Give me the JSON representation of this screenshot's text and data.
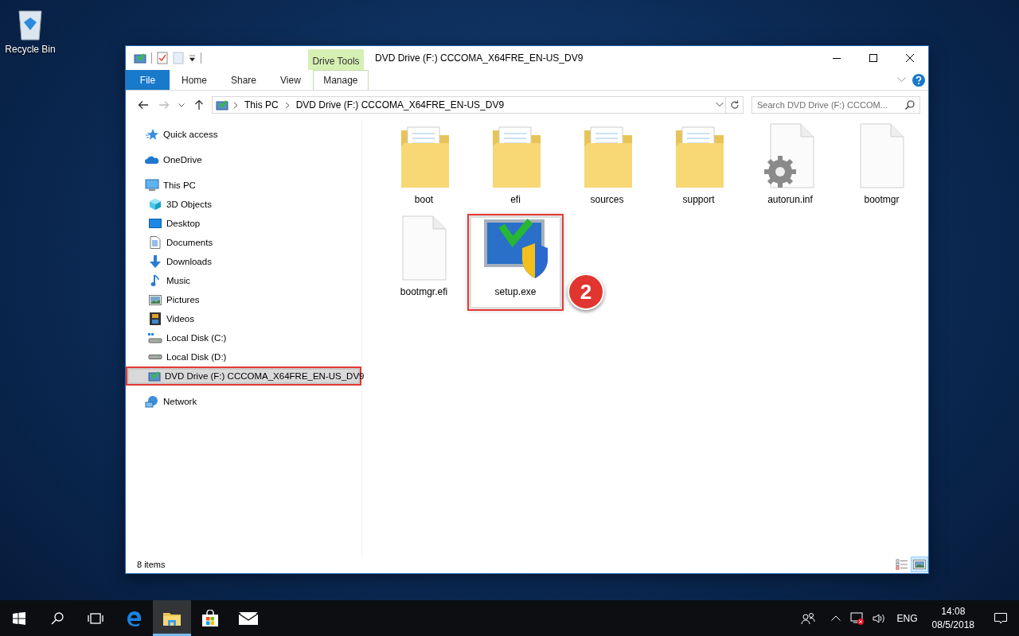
{
  "desktop_icons": [
    {
      "label": "Recycle Bin"
    }
  ],
  "window": {
    "title": "DVD Drive (F:) CCCOMA_X64FRE_EN-US_DV9",
    "contextual_group": "Drive Tools"
  },
  "ribbon_tabs": [
    {
      "label": "File",
      "kind": "file",
      "selected": false
    },
    {
      "label": "Home",
      "kind": "normal",
      "selected": false
    },
    {
      "label": "Share",
      "kind": "normal",
      "selected": false
    },
    {
      "label": "View",
      "kind": "normal",
      "selected": false
    },
    {
      "label": "Manage",
      "kind": "contextual",
      "selected": false
    }
  ],
  "address_bar": {
    "breadcrumbs": [
      "This PC",
      "DVD Drive (F:) CCCOMA_X64FRE_EN-US_DV9"
    ]
  },
  "search": {
    "placeholder": "Search DVD Drive (F:) CCCOM..."
  },
  "nav_items": [
    {
      "label": "Quick access",
      "kind": "star",
      "selected": false,
      "highlighted": false
    },
    {
      "label": "OneDrive",
      "kind": "cloud",
      "selected": false,
      "highlighted": false
    },
    {
      "label": "This PC",
      "kind": "pc",
      "selected": false,
      "highlighted": false,
      "children": [
        {
          "label": "3D Objects",
          "kind": "cube",
          "selected": false,
          "highlighted": false
        },
        {
          "label": "Desktop",
          "kind": "desktop",
          "selected": false,
          "highlighted": false
        },
        {
          "label": "Documents",
          "kind": "document",
          "selected": false,
          "highlighted": false
        },
        {
          "label": "Downloads",
          "kind": "download",
          "selected": false,
          "highlighted": false
        },
        {
          "label": "Music",
          "kind": "music",
          "selected": false,
          "highlighted": false
        },
        {
          "label": "Pictures",
          "kind": "picture",
          "selected": false,
          "highlighted": false
        },
        {
          "label": "Videos",
          "kind": "video",
          "selected": false,
          "highlighted": false
        },
        {
          "label": "Local Disk (C:)",
          "kind": "system-disk",
          "selected": false,
          "highlighted": false
        },
        {
          "label": "Local Disk (D:)",
          "kind": "disk",
          "selected": false,
          "highlighted": false
        },
        {
          "label": "DVD Drive (F:) CCCOMA_X64FRE_EN-US_DV9",
          "kind": "dvd",
          "selected": true,
          "highlighted": true
        }
      ]
    },
    {
      "label": "Network",
      "kind": "network",
      "selected": false,
      "highlighted": false
    }
  ],
  "files": [
    {
      "name": "boot",
      "kind": "folder",
      "highlighted": false
    },
    {
      "name": "efi",
      "kind": "folder",
      "highlighted": false
    },
    {
      "name": "sources",
      "kind": "folder",
      "highlighted": false
    },
    {
      "name": "support",
      "kind": "folder",
      "highlighted": false
    },
    {
      "name": "autorun.inf",
      "kind": "settings",
      "highlighted": false
    },
    {
      "name": "bootmgr",
      "kind": "blank",
      "highlighted": false
    },
    {
      "name": "bootmgr.efi",
      "kind": "blank",
      "highlighted": false
    },
    {
      "name": "setup.exe",
      "kind": "setup",
      "highlighted": true
    }
  ],
  "callout": {
    "label": "2"
  },
  "status_bar": {
    "item_count": "8 items"
  },
  "taskbar": {
    "apps": [
      {
        "kind": "start",
        "active": false
      },
      {
        "kind": "search",
        "active": false
      },
      {
        "kind": "task-view",
        "active": false
      },
      {
        "kind": "edge",
        "active": false
      },
      {
        "kind": "explorer",
        "active": true
      },
      {
        "kind": "store",
        "active": false
      },
      {
        "kind": "mail",
        "active": false
      }
    ],
    "language": "ENG",
    "time": "14:08",
    "date": "08/5/2018"
  }
}
